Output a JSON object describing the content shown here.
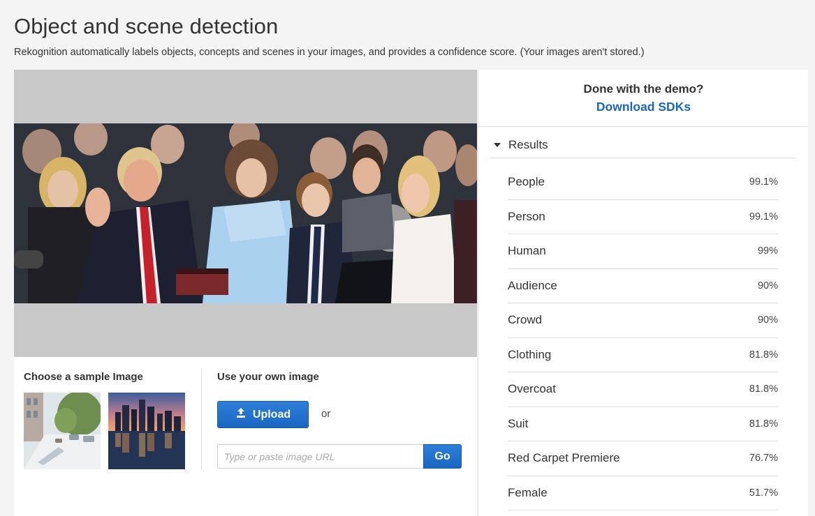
{
  "header": {
    "title": "Object and scene detection",
    "subtitle": "Rekognition automatically labels objects, concepts and scenes in your images, and provides a confidence score. (Your images aren't stored.)"
  },
  "controls": {
    "sample_title": "Choose a sample Image",
    "own_title": "Use your own image",
    "upload_label": "Upload",
    "or_text": "or",
    "url_placeholder": "Type or paste image URL",
    "go_label": "Go"
  },
  "demo": {
    "question": "Done with the demo?",
    "link": "Download SDKs"
  },
  "results": {
    "label": "Results",
    "items": [
      {
        "name": "People",
        "score": "99.1%"
      },
      {
        "name": "Person",
        "score": "99.1%"
      },
      {
        "name": "Human",
        "score": "99%"
      },
      {
        "name": "Audience",
        "score": "90%"
      },
      {
        "name": "Crowd",
        "score": "90%"
      },
      {
        "name": "Clothing",
        "score": "81.8%"
      },
      {
        "name": "Overcoat",
        "score": "81.8%"
      },
      {
        "name": "Suit",
        "score": "81.8%"
      },
      {
        "name": "Red Carpet Premiere",
        "score": "76.7%"
      },
      {
        "name": "Female",
        "score": "51.7%"
      }
    ]
  },
  "colors": {
    "accent_blue": "#1a66c0",
    "page_bg": "#f4f4f4",
    "image_bg": "#c8c8c8"
  },
  "icons": {
    "upload": "upload-icon",
    "caret": "caret-down-icon"
  }
}
